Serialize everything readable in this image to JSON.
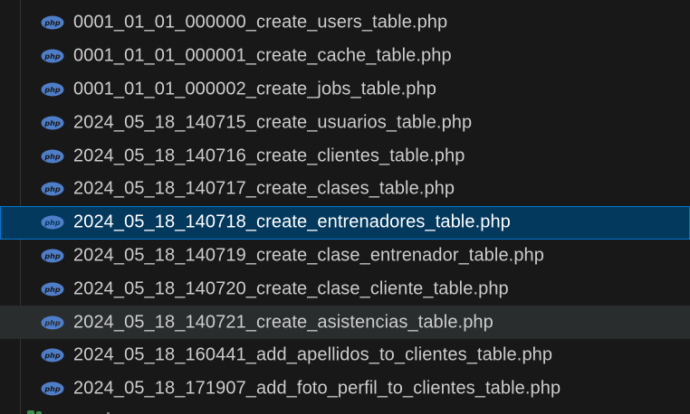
{
  "explorer": {
    "files": [
      {
        "name": "0001_01_01_000000_create_users_table.php",
        "icon": "php-icon"
      },
      {
        "name": "0001_01_01_000001_create_cache_table.php",
        "icon": "php-icon"
      },
      {
        "name": "0001_01_01_000002_create_jobs_table.php",
        "icon": "php-icon"
      },
      {
        "name": "2024_05_18_140715_create_usuarios_table.php",
        "icon": "php-icon"
      },
      {
        "name": "2024_05_18_140716_create_clientes_table.php",
        "icon": "php-icon"
      },
      {
        "name": "2024_05_18_140717_create_clases_table.php",
        "icon": "php-icon"
      },
      {
        "name": "2024_05_18_140718_create_entrenadores_table.php",
        "icon": "php-icon",
        "state": "selected"
      },
      {
        "name": "2024_05_18_140719_create_clase_entrenador_table.php",
        "icon": "php-icon"
      },
      {
        "name": "2024_05_18_140720_create_clase_cliente_table.php",
        "icon": "php-icon"
      },
      {
        "name": "2024_05_18_140721_create_asistencias_table.php",
        "icon": "php-icon",
        "state": "hover"
      },
      {
        "name": "2024_05_18_160441_add_apellidos_to_clientes_table.php",
        "icon": "php-icon"
      },
      {
        "name": "2024_05_18_171907_add_foto_perfil_to_clientes_table.php",
        "icon": "php-icon"
      }
    ]
  },
  "colors": {
    "background": "#181818",
    "text": "#cccccc",
    "selected_background": "#04395e",
    "selected_border": "#0078d4",
    "hover_background": "#2a2d2e",
    "php_icon": "#4f7ec9"
  }
}
